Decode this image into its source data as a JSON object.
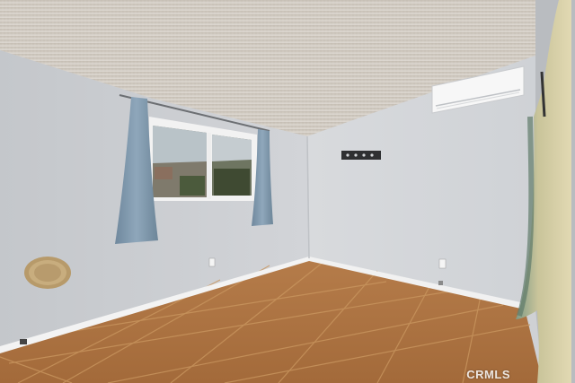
{
  "scene": {
    "description_kind": "photo",
    "colors": {
      "ceiling": "#cfc8bf",
      "left_wall": "#c9ccd0",
      "back_wall": "#d3d5d8",
      "floor_tile": "#a9703f",
      "grout": "#c99a6a",
      "baseboard": "#f4f4f4",
      "curtain": "#7f98ad",
      "right_curtain": "#a9b39a"
    }
  },
  "watermark": {
    "text": "CRMLS"
  }
}
